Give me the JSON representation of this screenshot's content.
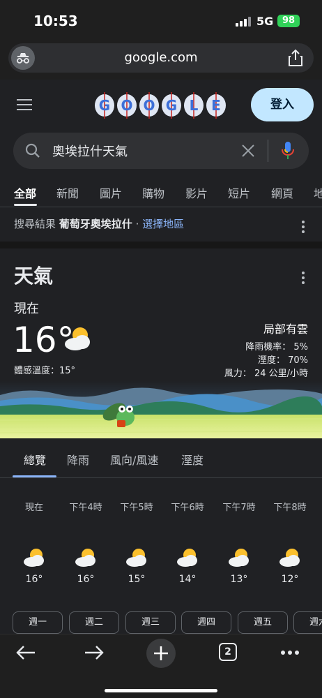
{
  "status": {
    "time": "10:53",
    "network": "5G",
    "battery": "98"
  },
  "browser": {
    "url": "google.com",
    "tab_count": "2"
  },
  "header": {
    "login_label": "登入",
    "doodle_letters": [
      "G",
      "O",
      "O",
      "G",
      "L",
      "E"
    ]
  },
  "search": {
    "query": "奧埃拉什天氣"
  },
  "tabs": [
    {
      "label": "全部",
      "active": true
    },
    {
      "label": "新聞"
    },
    {
      "label": "圖片"
    },
    {
      "label": "購物"
    },
    {
      "label": "影片"
    },
    {
      "label": "短片"
    },
    {
      "label": "網頁"
    },
    {
      "label": "地"
    }
  ],
  "region": {
    "prefix": "搜尋結果",
    "location": "葡萄牙奧埃拉什",
    "separator": "·",
    "link": "選擇地區"
  },
  "weather": {
    "title": "天氣",
    "now_label": "現在",
    "temp": "16°",
    "feels_like": "體感溫度：15°",
    "condition": "局部有雲",
    "precip": "降雨機率： 5%",
    "humidity": "溼度： 70%",
    "wind": "風力： 24 公里/小時",
    "tabs": [
      "總覽",
      "降雨",
      "風向/風速",
      "溼度"
    ],
    "hourly": [
      {
        "label": "現在",
        "temp": "16°",
        "icon": "partly-cloudy-icon"
      },
      {
        "label": "下午4時",
        "temp": "16°",
        "icon": "partly-cloudy-icon"
      },
      {
        "label": "下午5時",
        "temp": "15°",
        "icon": "partly-cloudy-icon"
      },
      {
        "label": "下午6時",
        "temp": "14°",
        "icon": "partly-cloudy-icon"
      },
      {
        "label": "下午7時",
        "temp": "13°",
        "icon": "partly-cloudy-icon"
      },
      {
        "label": "下午8時",
        "temp": "12°",
        "icon": "partly-cloudy-icon"
      }
    ],
    "days": [
      "週一",
      "週二",
      "週三",
      "週四",
      "週五",
      "週六"
    ]
  },
  "colors": {
    "accent": "#8ab4f8",
    "login_bg": "#c2e7ff",
    "background": "#202124"
  }
}
